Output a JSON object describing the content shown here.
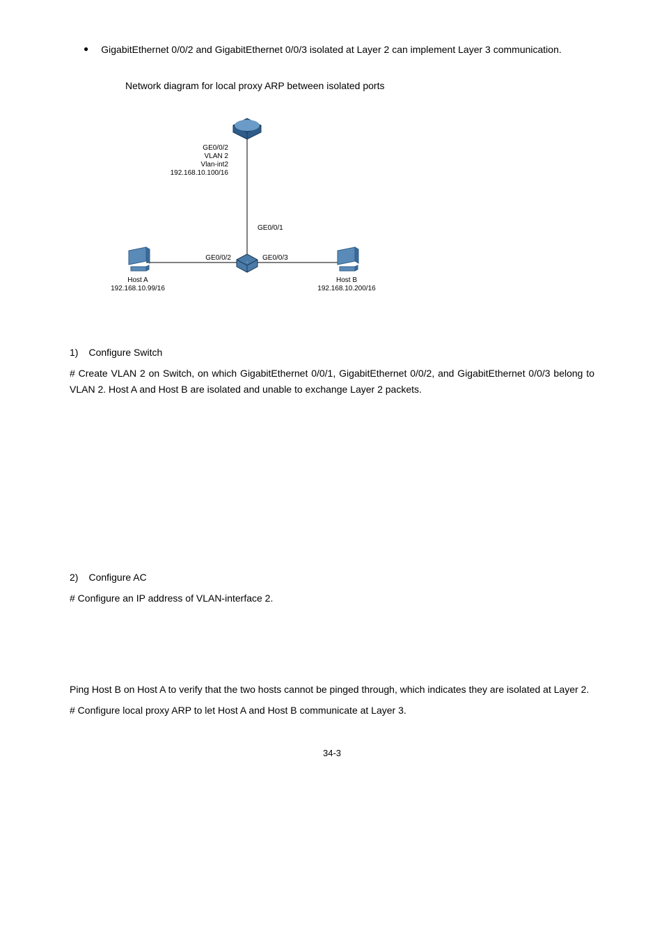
{
  "bullet1": "GigabitEthernet 0/0/2 and GigabitEthernet 0/0/3 isolated at Layer 2 can implement Layer 3 communication.",
  "figureTitle": "Network diagram for local proxy ARP between isolated ports",
  "diagram": {
    "topLabels": {
      "l1": "GE0/0/2",
      "l2": "VLAN 2",
      "l3": "Vlan-int2",
      "l4": "192.168.10.100/16"
    },
    "midLabel": "GE0/0/1",
    "leftPort": "GE0/0/2",
    "rightPort": "GE0/0/3",
    "hostA": {
      "name": "Host A",
      "ip": "192.168.10.99/16"
    },
    "hostB": {
      "name": "Host B",
      "ip": "192.168.10.200/16"
    }
  },
  "step1": {
    "num": "1)",
    "title": "Configure Switch",
    "text": "# Create VLAN 2 on Switch, on which GigabitEthernet 0/0/1, GigabitEthernet 0/0/2, and GigabitEthernet 0/0/3 belong to VLAN 2. Host A and Host B are isolated and unable to exchange Layer 2 packets."
  },
  "step2": {
    "num": "2)",
    "title": "Configure AC",
    "text1": "# Configure an IP address of VLAN-interface 2.",
    "text2": "Ping Host B on Host A to verify that the two hosts cannot be pinged through, which indicates they are isolated at Layer 2.",
    "text3": "# Configure local proxy ARP to let Host A and Host B communicate at Layer 3."
  },
  "pageNum": "34-3"
}
